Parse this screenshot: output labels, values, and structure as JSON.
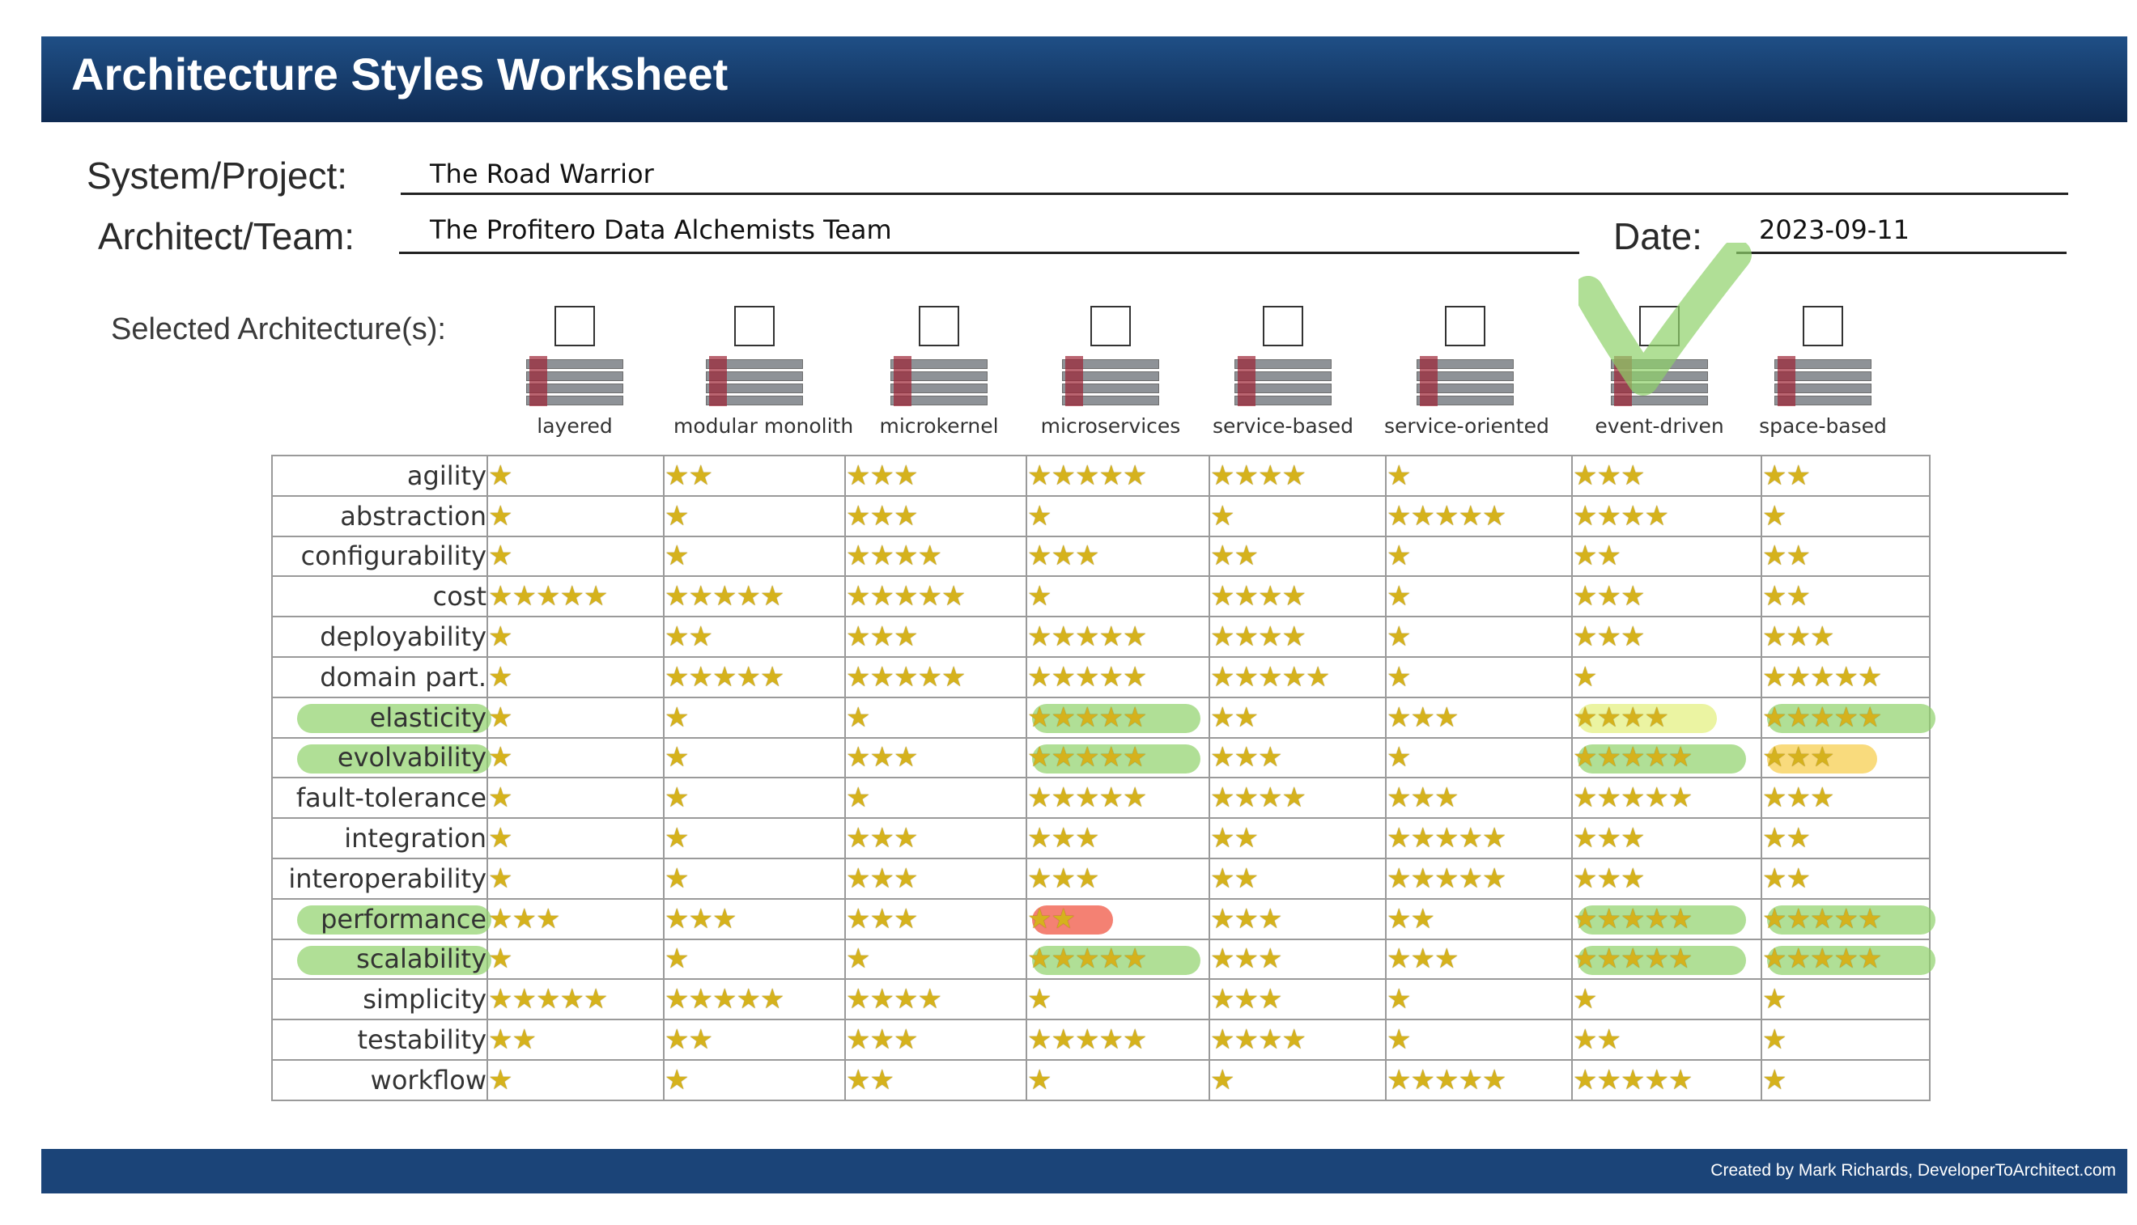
{
  "header": {
    "title": "Architecture Styles Worksheet"
  },
  "form": {
    "project_label": "System/Project:",
    "project_value": "The Road Warrior",
    "architect_label": "Architect/Team:",
    "architect_value": "The Profitero Data Alchemists Team",
    "date_label": "Date:",
    "date_value": "2023-09-11",
    "selected_label": "Selected Architecture(s):"
  },
  "architectures": [
    {
      "name": "layered",
      "selected": false
    },
    {
      "name": "modular monolith",
      "selected": false
    },
    {
      "name": "microkernel",
      "selected": false
    },
    {
      "name": "microservices",
      "selected": false
    },
    {
      "name": "service-based",
      "selected": false
    },
    {
      "name": "service-oriented",
      "selected": false
    },
    {
      "name": "event-driven",
      "selected": true
    },
    {
      "name": "space-based",
      "selected": false
    }
  ],
  "colors": {
    "green_highlight": "#8fd16a",
    "yellow_highlight": "#e2ef7a",
    "orange_highlight": "#f7cc46",
    "red_highlight": "#f26b5b",
    "star": "#d5b21d",
    "header": "#17406f"
  },
  "characteristics": [
    {
      "name": "agility",
      "highlight": "",
      "ratings": [
        1,
        2,
        3,
        5,
        4,
        1,
        3,
        2
      ]
    },
    {
      "name": "abstraction",
      "highlight": "",
      "ratings": [
        1,
        1,
        3,
        1,
        1,
        5,
        4,
        1
      ]
    },
    {
      "name": "configurability",
      "highlight": "",
      "ratings": [
        1,
        1,
        4,
        3,
        2,
        1,
        2,
        2
      ]
    },
    {
      "name": "cost",
      "highlight": "",
      "ratings": [
        5,
        5,
        5,
        1,
        4,
        1,
        3,
        2
      ]
    },
    {
      "name": "deployability",
      "highlight": "",
      "ratings": [
        1,
        2,
        3,
        5,
        4,
        1,
        3,
        3
      ]
    },
    {
      "name": "domain part.",
      "highlight": "",
      "ratings": [
        1,
        5,
        5,
        5,
        5,
        1,
        1,
        5
      ]
    },
    {
      "name": "elasticity",
      "highlight": "green",
      "ratings": [
        1,
        1,
        1,
        5,
        2,
        3,
        4,
        5
      ]
    },
    {
      "name": "evolvability",
      "highlight": "green",
      "ratings": [
        1,
        1,
        3,
        5,
        3,
        1,
        5,
        3
      ]
    },
    {
      "name": "fault-tolerance",
      "highlight": "",
      "ratings": [
        1,
        1,
        1,
        5,
        4,
        3,
        5,
        3
      ]
    },
    {
      "name": "integration",
      "highlight": "",
      "ratings": [
        1,
        1,
        3,
        3,
        2,
        5,
        3,
        2
      ]
    },
    {
      "name": "interoperability",
      "highlight": "",
      "ratings": [
        1,
        1,
        3,
        3,
        2,
        5,
        3,
        2
      ]
    },
    {
      "name": "performance",
      "highlight": "green",
      "ratings": [
        3,
        3,
        3,
        2,
        3,
        2,
        5,
        5
      ]
    },
    {
      "name": "scalability",
      "highlight": "green",
      "ratings": [
        1,
        1,
        1,
        5,
        3,
        3,
        5,
        5
      ]
    },
    {
      "name": "simplicity",
      "highlight": "",
      "ratings": [
        5,
        5,
        4,
        1,
        3,
        1,
        1,
        1
      ]
    },
    {
      "name": "testability",
      "highlight": "",
      "ratings": [
        2,
        2,
        3,
        5,
        4,
        1,
        2,
        1
      ]
    },
    {
      "name": "workflow",
      "highlight": "",
      "ratings": [
        1,
        1,
        2,
        1,
        1,
        5,
        5,
        1
      ]
    }
  ],
  "cell_highlights": [
    {
      "row": 6,
      "col": 3,
      "color": "green"
    },
    {
      "row": 6,
      "col": 6,
      "color": "yellow"
    },
    {
      "row": 6,
      "col": 7,
      "color": "green"
    },
    {
      "row": 7,
      "col": 3,
      "color": "green"
    },
    {
      "row": 7,
      "col": 6,
      "color": "green"
    },
    {
      "row": 7,
      "col": 7,
      "color": "orange"
    },
    {
      "row": 11,
      "col": 3,
      "color": "red"
    },
    {
      "row": 11,
      "col": 6,
      "color": "green"
    },
    {
      "row": 11,
      "col": 7,
      "color": "green"
    },
    {
      "row": 12,
      "col": 3,
      "color": "green"
    },
    {
      "row": 12,
      "col": 6,
      "color": "green"
    },
    {
      "row": 12,
      "col": 7,
      "color": "green"
    }
  ],
  "icons": {
    "star": "star-icon",
    "checkmark": "checkmark-icon"
  },
  "footer": {
    "credit": "Created by Mark Richards, DeveloperToArchitect.com"
  }
}
